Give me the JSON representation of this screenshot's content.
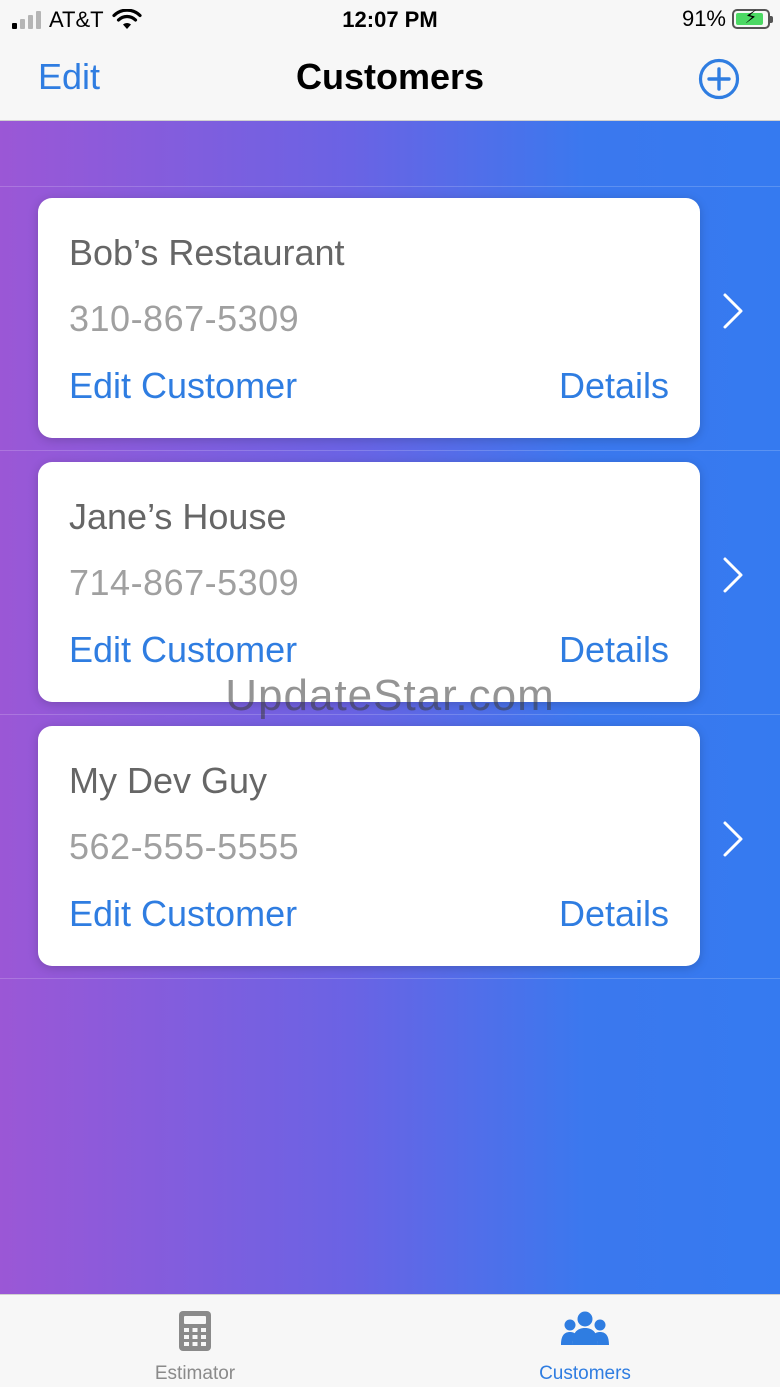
{
  "status_bar": {
    "carrier": "AT&T",
    "time": "12:07 PM",
    "battery_percent": "91%",
    "battery_level": 0.91,
    "signal_bars_active": 1,
    "signal_bars_total": 4,
    "charging": true,
    "battery_color": "#4cd964"
  },
  "nav": {
    "edit_label": "Edit",
    "title": "Customers",
    "add_icon": "plus-circle-icon"
  },
  "customers": [
    {
      "name": "Bob’s Restaurant",
      "phone": "310-867-5309",
      "edit_label": "Edit Customer",
      "details_label": "Details"
    },
    {
      "name": "Jane’s House",
      "phone": "714-867-5309",
      "edit_label": "Edit Customer",
      "details_label": "Details"
    },
    {
      "name": "My Dev Guy",
      "phone": "562-555-5555",
      "edit_label": "Edit Customer",
      "details_label": "Details"
    }
  ],
  "watermark": "UpdateStar.com",
  "tabs": [
    {
      "label": "Estimator",
      "icon": "calculator-icon",
      "selected": false
    },
    {
      "label": "Customers",
      "icon": "people-icon",
      "selected": true
    }
  ],
  "colors": {
    "accent": "#2f7de1",
    "gradient_start": "#9b57d6",
    "gradient_end": "#357af0",
    "tab_inactive": "#8a8a8a"
  }
}
